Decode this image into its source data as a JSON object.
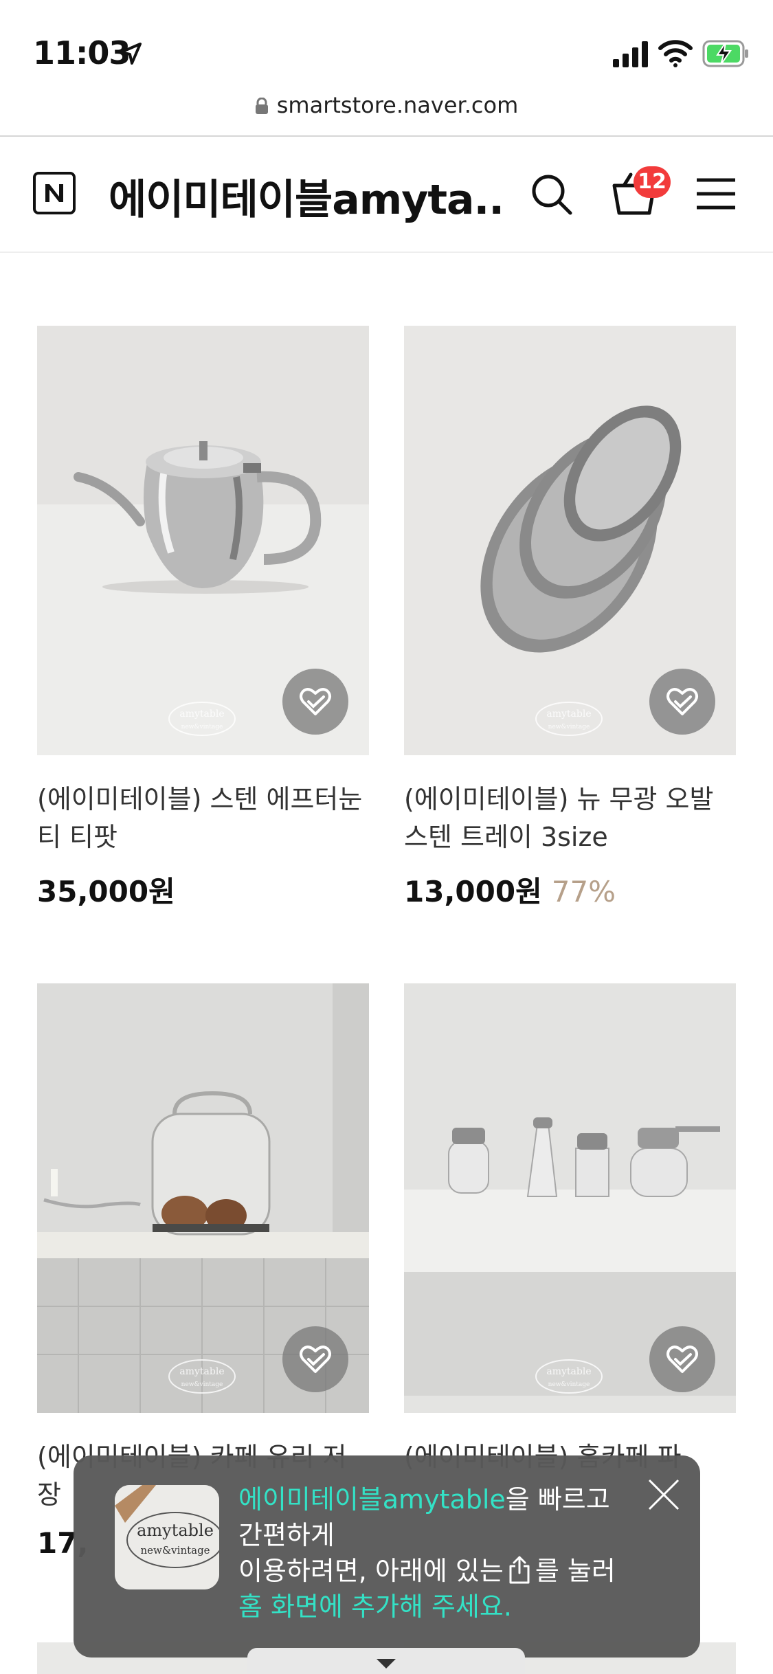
{
  "status_bar": {
    "time": "11:03"
  },
  "browser": {
    "url": "smartstore.naver.com"
  },
  "header": {
    "logo_letter": "N",
    "store_title": "에이미테이블amyta...",
    "cart_count": "12"
  },
  "products": [
    {
      "name": "(에이미테이블) 스텐 에프터눈티 티팟",
      "price": "35,000원",
      "discount": "",
      "watermark": "amytable new&vintage"
    },
    {
      "name": "(에이미테이블) 뉴 무광 오발 스텐 트레이 3size",
      "price": "13,000원",
      "discount": "77%",
      "watermark": "amytable new&vintage"
    },
    {
      "name": "(에이미테이블) 카페 유리 저장",
      "price": "17,",
      "discount": "",
      "watermark": "amytable new&vintage"
    },
    {
      "name": "(에이미테이블) 홈카페 파",
      "price": "",
      "discount": "",
      "watermark": "amytable new&vintage"
    }
  ],
  "popup": {
    "store_name": "에이미테이블amytable",
    "line1_suffix": "을 빠르고",
    "line2": "간편하게",
    "line3_prefix": "이용하려면, 아래에 있는",
    "line3_suffix": "를 눌러",
    "line4": "홈 화면에 추가해 주세요.",
    "thumb_text_1": "amytable",
    "thumb_text_2": "new&vintage"
  }
}
